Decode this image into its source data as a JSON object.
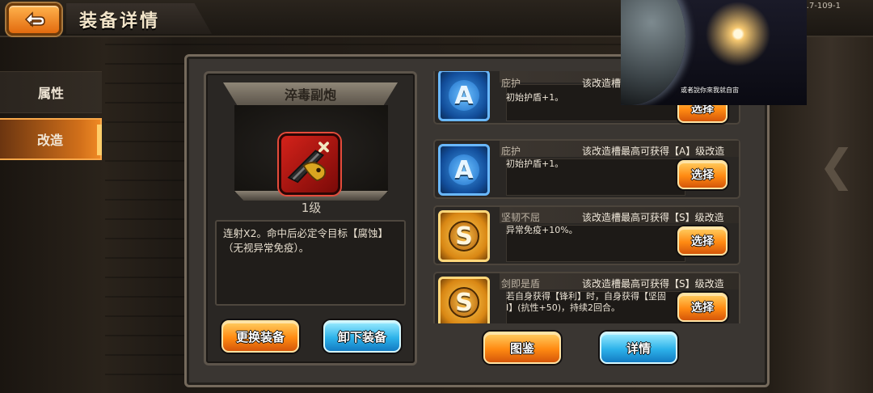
{
  "header": {
    "title": "装备详情",
    "version": "1.7-109-1"
  },
  "sidebar": {
    "items": [
      {
        "label": "属性",
        "active": false
      },
      {
        "label": "改造",
        "active": true
      }
    ]
  },
  "equipment": {
    "name": "淬毒副炮",
    "level": "1级",
    "description": "连射X2。命中后必定令目标【腐蚀】（无视异常免疫）。",
    "buttons": {
      "change": "更换装备",
      "remove": "卸下装备"
    }
  },
  "mod_slots": [
    {
      "grade": "A",
      "name": "庇护",
      "cap": "该改造槽最高可获得【A】级改造",
      "effect": "初始护盾+1。",
      "button": "选择"
    },
    {
      "grade": "A",
      "name": "庇护",
      "cap": "该改造槽最高可获得【A】级改造",
      "effect": "初始护盾+1。",
      "button": "选择"
    },
    {
      "grade": "S",
      "name": "坚韧不屈",
      "cap": "该改造槽最高可获得【S】级改造",
      "effect": "异常免疫+10%。",
      "button": "选择"
    },
    {
      "grade": "S",
      "name": "剑即是盾",
      "cap": "该改造槽最高可获得【S】级改造",
      "effect": "若自身获得【锋利】时，自身获得【坚固Ⅰ】(抗性+50)，持续2回合。",
      "button": "选择"
    }
  ],
  "footer_buttons": {
    "atlas": "图鉴",
    "detail": "详情"
  },
  "overlay": {
    "subtitle": "或者說你來我就自宙"
  },
  "colors": {
    "orange_button": "#ff8a12",
    "blue_button": "#2db2ea",
    "badge_A": "#1f6fc8",
    "badge_S": "#d98714"
  }
}
